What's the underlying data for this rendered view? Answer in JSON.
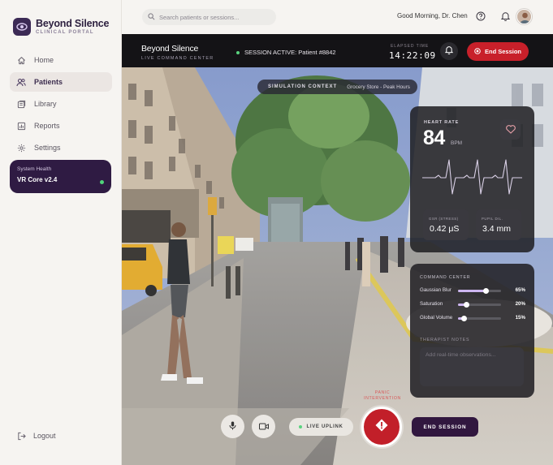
{
  "brand": {
    "title": "Beyond Silence",
    "subtitle": "CLINICAL PORTAL"
  },
  "nav": {
    "items": [
      {
        "label": "Home",
        "icon": "home-icon",
        "active": false
      },
      {
        "label": "Patients",
        "icon": "users-icon",
        "active": true
      },
      {
        "label": "Library",
        "icon": "library-icon",
        "active": false
      },
      {
        "label": "Reports",
        "icon": "chart-icon",
        "active": false
      },
      {
        "label": "Settings",
        "icon": "gear-icon",
        "active": false
      }
    ]
  },
  "system_health": {
    "label": "System Health",
    "value": "VR Core v2.4",
    "status_color": "#4fd47a"
  },
  "logout": {
    "label": "Logout"
  },
  "topbar": {
    "search_placeholder": "Search patients or sessions...",
    "greeting": "Good Morning, Dr. Chen"
  },
  "session": {
    "title": "Beyond Silence",
    "subtitle": "LIVE COMMAND CENTER",
    "status": "SESSION ACTIVE: Patient #8842",
    "elapsed_label": "ELAPSED TIME",
    "elapsed_time": "14:22:09",
    "end_label": "End Session"
  },
  "context": {
    "label": "SIMULATION CONTEXT",
    "value": "Grocery Store - Peak Hours"
  },
  "vitals": {
    "heart_rate_label": "HEART RATE",
    "heart_rate": "84",
    "heart_rate_unit": "BPM",
    "gsr_label": "GSR (STRESS)",
    "gsr_value": "0.42 μS",
    "pupil_label": "PUPIL DIL.",
    "pupil_value": "3.4 mm"
  },
  "command_center": {
    "title": "COMMAND CENTER",
    "sliders": [
      {
        "label": "Gaussian Blur",
        "value": 65,
        "display": "65%"
      },
      {
        "label": "Saturation",
        "value": 20,
        "display": "20%"
      },
      {
        "label": "Global Volume",
        "value": 15,
        "display": "15%"
      }
    ],
    "notes_label": "THERAPIST NOTES",
    "notes_placeholder": "Add real-time observations..."
  },
  "controls": {
    "uplink_label": "LIVE UPLINK",
    "panic_label": "PANIC INTERVENTION",
    "end_session_label": "END SESSION"
  },
  "colors": {
    "accent": "#c8202a",
    "brand": "#2f1b43",
    "slider": "#cdb6f0"
  }
}
